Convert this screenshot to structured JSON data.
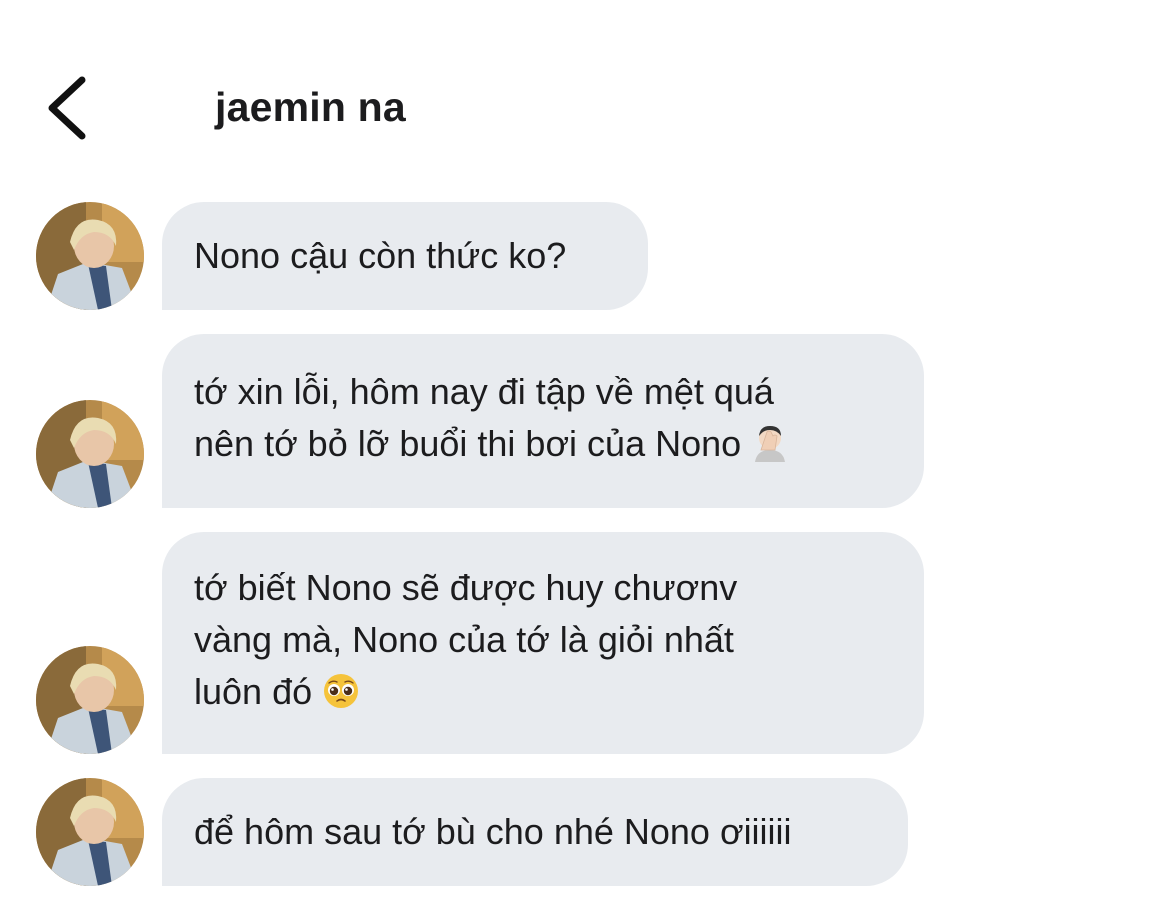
{
  "header": {
    "title": "jaemin na",
    "back_icon": "chevron-left-icon"
  },
  "messages": [
    {
      "text": "Nono cậu còn thức ko?",
      "emoji": null
    },
    {
      "text": "tớ xin lỗi, hôm nay đi tập về mệt quá\nnên tớ bỏ lỡ buổi thi bơi của Nono",
      "emoji": "facepalm-emoji"
    },
    {
      "text": "tớ biết Nono sẽ được huy chươnv\nvàng mà, Nono của tớ là giỏi nhất\nluôn đó",
      "emoji": "pleading-face-emoji"
    },
    {
      "text": "để hôm sau tớ bù cho nhé Nono ơiiiiii",
      "emoji": null
    }
  ],
  "colors": {
    "bubble": "#e8ebef",
    "text": "#1c1c1e",
    "background": "#ffffff"
  }
}
